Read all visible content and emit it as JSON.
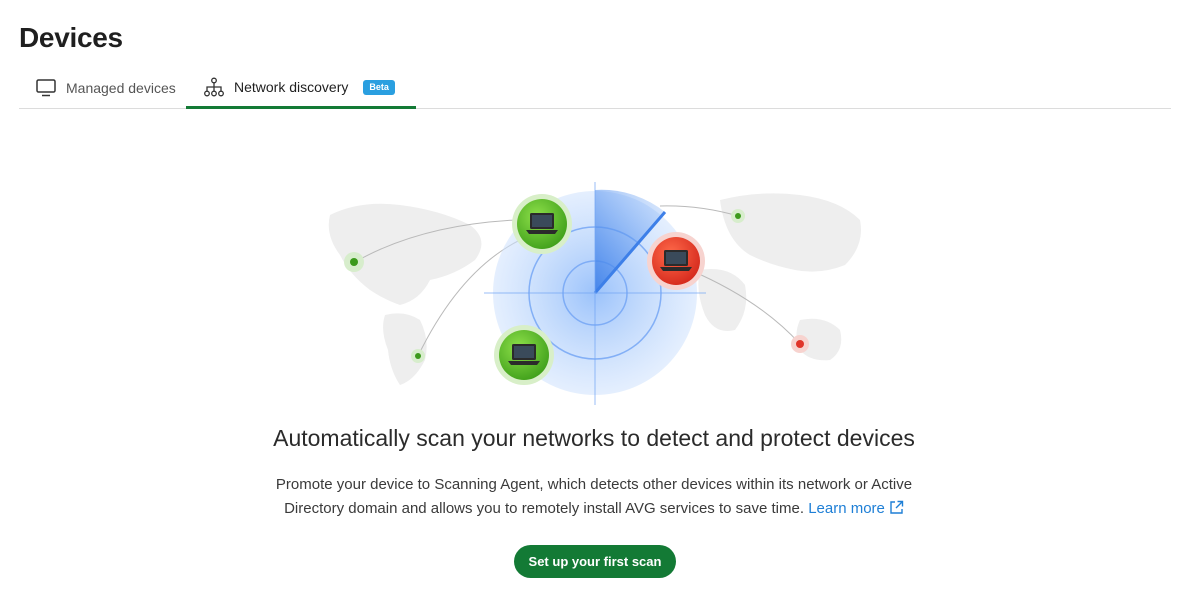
{
  "page": {
    "title": "Devices"
  },
  "tabs": [
    {
      "label": "Managed devices",
      "icon": "monitor-icon",
      "active": false
    },
    {
      "label": "Network discovery",
      "icon": "network-tree-icon",
      "active": true,
      "badge": "Beta"
    }
  ],
  "empty_state": {
    "headline": "Automatically scan your networks to detect and protect devices",
    "description": "Promote your device to Scanning Agent, which detects other devices within its network or Active Directory domain and allows you to remotely install AVG services to save time.",
    "learn_more": "Learn more",
    "cta_label": "Set up your first scan"
  },
  "colors": {
    "accent_green": "#137a35",
    "badge_blue": "#2a9fe0",
    "link_blue": "#1e7fd6",
    "device_green": "#5fbf2a",
    "device_red": "#e8392a",
    "radar_blue": "#4a8ff0"
  }
}
